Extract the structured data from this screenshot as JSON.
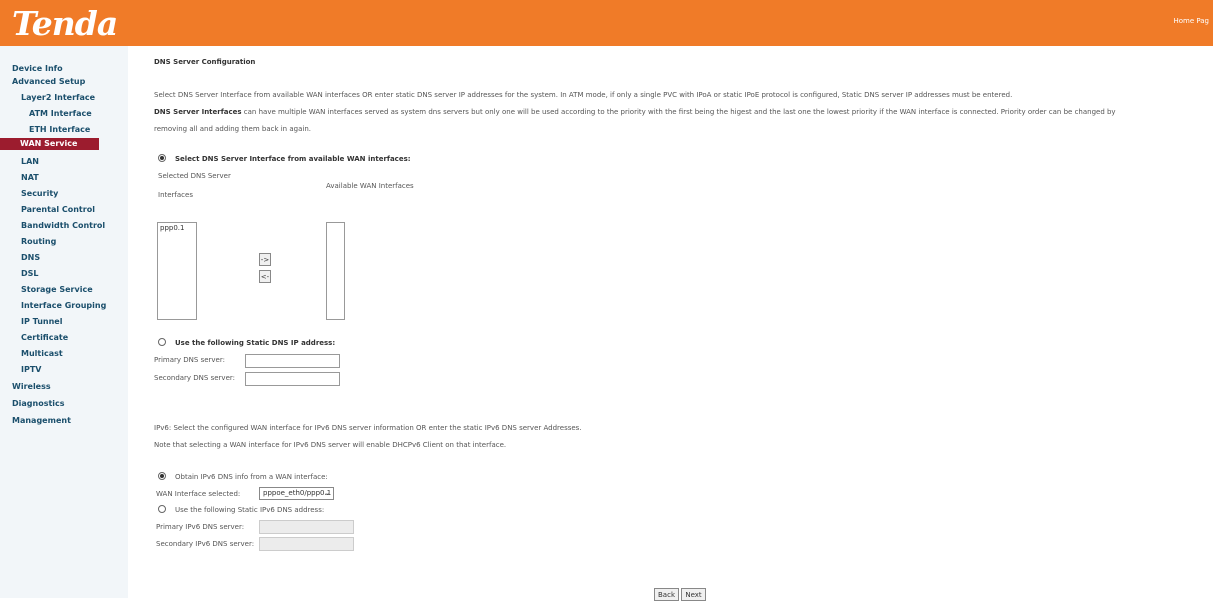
{
  "header": {
    "logo": "Tenda",
    "link": "Home Pag"
  },
  "sidebar": {
    "items": [
      {
        "label": "Device Info"
      },
      {
        "label": "Advanced Setup"
      },
      {
        "label": "Layer2 Interface"
      },
      {
        "label": "ATM Interface"
      },
      {
        "label": "ETH Interface"
      },
      {
        "label": "WAN Service"
      },
      {
        "label": "LAN"
      },
      {
        "label": "NAT"
      },
      {
        "label": "Security"
      },
      {
        "label": "Parental Control"
      },
      {
        "label": "Bandwidth Control"
      },
      {
        "label": "Routing"
      },
      {
        "label": "DNS"
      },
      {
        "label": "DSL"
      },
      {
        "label": "Storage Service"
      },
      {
        "label": "Interface Grouping"
      },
      {
        "label": "IP Tunnel"
      },
      {
        "label": "Certificate"
      },
      {
        "label": "Multicast"
      },
      {
        "label": "IPTV"
      },
      {
        "label": "Wireless"
      },
      {
        "label": "Diagnostics"
      },
      {
        "label": "Management"
      }
    ]
  },
  "main": {
    "title": "DNS Server Configuration",
    "intro1": "Select DNS Server Interface from available WAN interfaces OR enter static DNS server IP addresses for the system. In ATM mode, if only a single PVC with IPoA or static IPoE protocol is configured, Static DNS server IP addresses must be entered.",
    "intro2_bold": "DNS Server Interfaces",
    "intro2_rest": " can have multiple WAN interfaces served as system dns servers but only one will be used according to the priority with the first being the higest and the last one the lowest priority if the WAN interface is connected. Priority order can be changed by",
    "intro3": "removing all and adding them back in again.",
    "opt_select_label": "Select DNS Server Interface from available WAN interfaces:",
    "selected_label_1": "Selected DNS Server",
    "selected_label_2": "Interfaces",
    "available_label": "Available WAN Interfaces",
    "selected_items": [
      "ppp0.1"
    ],
    "btn_right": "->",
    "btn_left": "<-",
    "opt_static_label": "Use the following Static DNS IP address:",
    "primary_dns_label": "Primary DNS server:",
    "secondary_dns_label": "Secondary DNS server:",
    "primary_dns_value": "",
    "secondary_dns_value": "",
    "ipv6_text1": "IPv6: Select the configured WAN interface for IPv6 DNS server information OR enter the static IPv6 DNS server Addresses.",
    "ipv6_text2": "Note that selecting a WAN interface for IPv6 DNS server will enable DHCPv6 Client on that interface.",
    "opt_ipv6_wan_label": "Obtain IPv6 DNS info from a WAN interface:",
    "wan_iface_label": "WAN Interface selected:",
    "wan_iface_value": "pppoe_eth0/ppp0.1",
    "opt_ipv6_static_label": "Use the following Static IPv6 DNS address:",
    "primary_ipv6_label": "Primary IPv6 DNS server:",
    "secondary_ipv6_label": "Secondary IPv6 DNS server:",
    "back": "Back",
    "next": "Next"
  }
}
